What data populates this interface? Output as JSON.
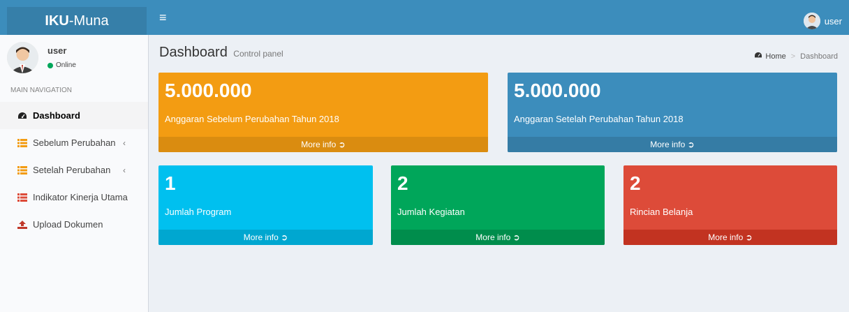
{
  "topbar": {
    "logo_bold": "IKU",
    "logo_rest": "-Muna",
    "toggle_icon": "≡",
    "username": "user"
  },
  "sidebar": {
    "user": {
      "name": "user",
      "status": "Online"
    },
    "nav_header": "MAIN NAVIGATION",
    "items": [
      {
        "label": "Dashboard",
        "icon": "dashboard-icon"
      },
      {
        "label": "Sebelum Perubahan",
        "icon": "list-icon"
      },
      {
        "label": "Setelah Perubahan",
        "icon": "list-icon"
      },
      {
        "label": "Indikator Kinerja Utama",
        "icon": "list-icon"
      },
      {
        "label": "Upload Dokumen",
        "icon": "upload-icon"
      }
    ]
  },
  "header": {
    "title": "Dashboard",
    "subtitle": "Control panel",
    "breadcrumb_home": "Home",
    "breadcrumb_current": "Dashboard"
  },
  "boxes": [
    {
      "value": "5.000.000",
      "label": "Anggaran Sebelum Perubahan Tahun 2018",
      "footer": "More info",
      "color": "#f39c12",
      "footer_color": "#da8c10"
    },
    {
      "value": "5.000.000",
      "label": "Anggaran Setelah Perubahan Tahun 2018",
      "footer": "More info",
      "color": "#3c8dbc",
      "footer_color": "#357ca5"
    },
    {
      "value": "1",
      "label": "Jumlah Program",
      "footer": "More info",
      "color": "#00c0ef",
      "footer_color": "#00a7d0"
    },
    {
      "value": "2",
      "label": "Jumlah Kegiatan",
      "footer": "More info",
      "color": "#00a65a",
      "footer_color": "#008d4c"
    },
    {
      "value": "2",
      "label": "Rincian Belanja",
      "footer": "More info",
      "color": "#dd4b39",
      "footer_color": "#c23321"
    }
  ]
}
